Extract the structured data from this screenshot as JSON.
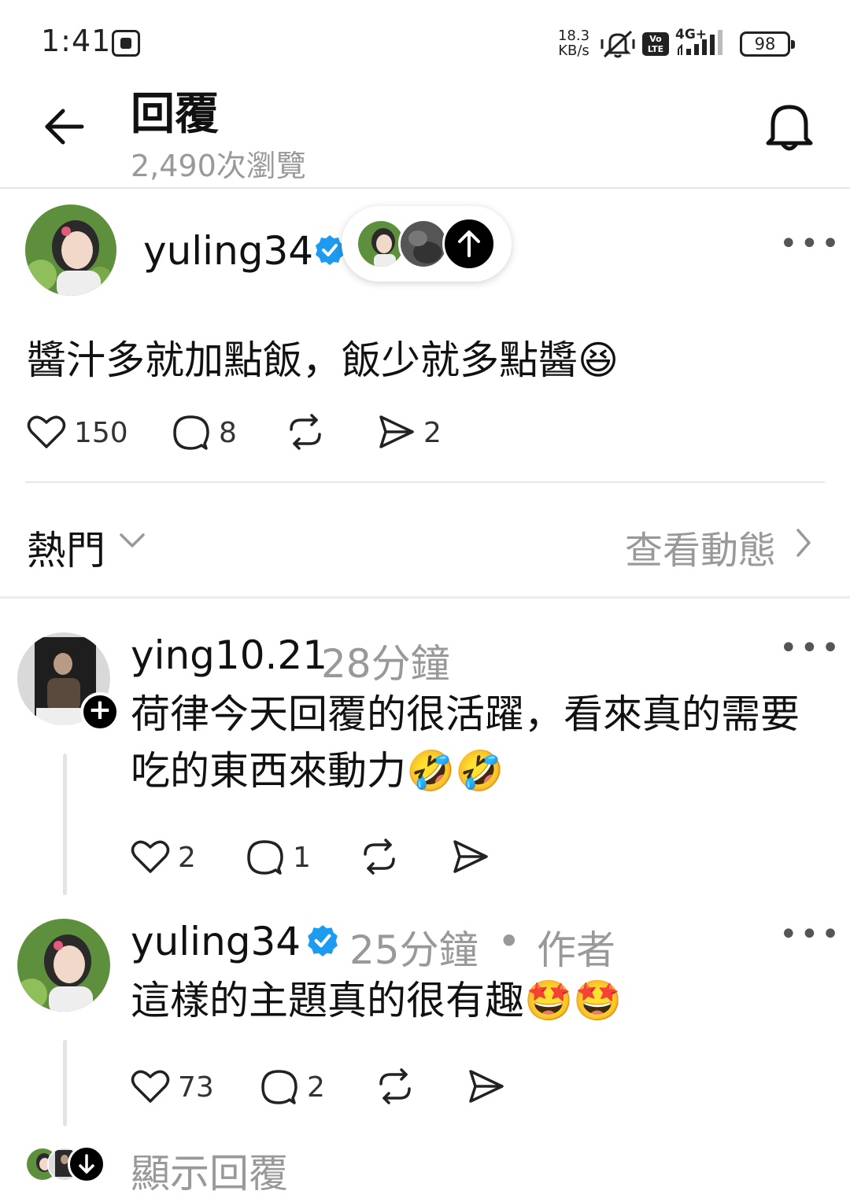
{
  "status_bar": {
    "time": "1:41",
    "speed_value": "18.3",
    "speed_unit": "KB/s",
    "volte": "Vo\nLTE",
    "network": "4G+",
    "battery": "98"
  },
  "header": {
    "title": "回覆",
    "views": "2,490次瀏覽"
  },
  "main_post": {
    "username": "yuling34",
    "text": "醬汁多就加點飯，飯少就多點醬😆",
    "likes": "150",
    "comments": "8",
    "shares": "2"
  },
  "filter": {
    "sort_label": "熱門",
    "activity_label": "查看動態"
  },
  "replies": [
    {
      "username": "ying10.21",
      "time": "28分鐘",
      "line1": "荷律今天回覆的很活躍，看來真的需要",
      "line2": "吃的東西來動力🤣🤣",
      "likes": "2",
      "comments": "1"
    },
    {
      "username": "yuling34",
      "time": "25分鐘",
      "separator": "•",
      "author_tag": "作者",
      "line1": "這樣的主題真的很有趣🤩🤩",
      "likes": "73",
      "comments": "2"
    }
  ],
  "show_replies": "顯示回覆",
  "colors": {
    "verified": "#1d9bf0",
    "secondary_text": "#999999",
    "divider": "#e6e6e6"
  }
}
